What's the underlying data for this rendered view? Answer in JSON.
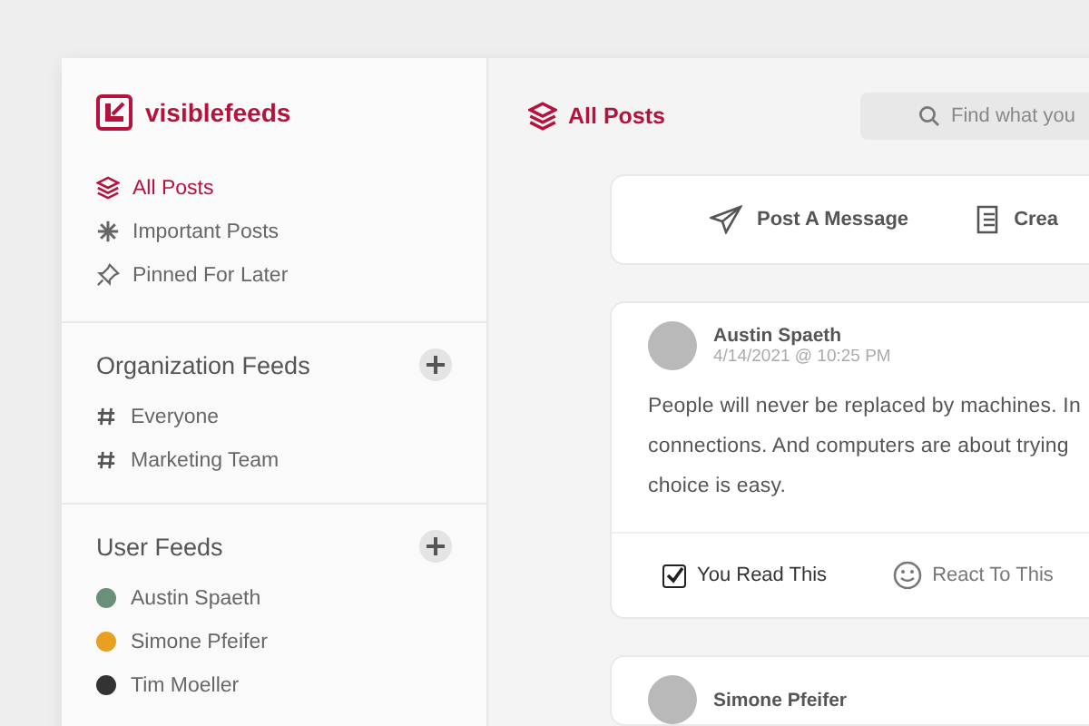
{
  "brand": {
    "name": "visiblefeeds"
  },
  "nav": [
    {
      "label": "All Posts",
      "selected": true
    },
    {
      "label": "Important Posts",
      "selected": false
    },
    {
      "label": "Pinned For Later",
      "selected": false
    }
  ],
  "sections": [
    {
      "title": "Organization Feeds",
      "kind": "channel",
      "items": [
        {
          "label": "Everyone"
        },
        {
          "label": "Marketing Team"
        }
      ]
    },
    {
      "title": "User Feeds",
      "kind": "user",
      "items": [
        {
          "label": "Austin Spaeth",
          "color": "#6a8f7a"
        },
        {
          "label": "Simone Pfeifer",
          "color": "#e8a020"
        },
        {
          "label": "Tim Moeller",
          "color": "#333333"
        }
      ]
    }
  ],
  "header": {
    "title": "All Posts",
    "search": {
      "placeholder": "Find what you"
    }
  },
  "actions": [
    {
      "label": "Post A Message"
    },
    {
      "label": "Crea"
    }
  ],
  "posts": [
    {
      "author": "Austin Spaeth",
      "date": "4/14/2021 @ 10:25 PM",
      "lines": [
        "People will never be replaced by machines. In",
        "connections. And computers are about trying",
        "choice is easy."
      ],
      "read": {
        "label": "You Read This",
        "checked": true
      },
      "react": "React To This"
    },
    {
      "author": "Simone Pfeifer"
    }
  ]
}
